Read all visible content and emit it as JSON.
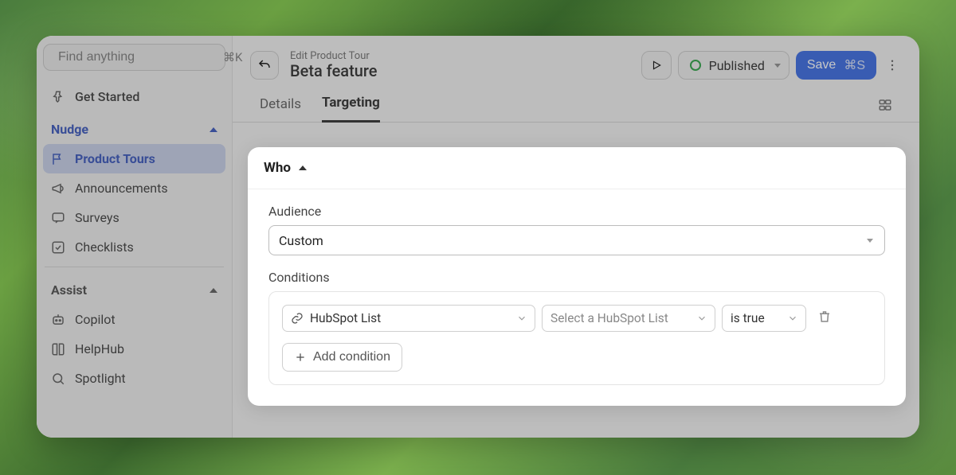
{
  "search": {
    "placeholder": "Find anything",
    "shortcut": "⌘K"
  },
  "sidebar": {
    "get_started": "Get Started",
    "nudge_label": "Nudge",
    "nudge_items": [
      {
        "label": "Product Tours"
      },
      {
        "label": "Announcements"
      },
      {
        "label": "Surveys"
      },
      {
        "label": "Checklists"
      }
    ],
    "assist_label": "Assist",
    "assist_items": [
      {
        "label": "Copilot"
      },
      {
        "label": "HelpHub"
      },
      {
        "label": "Spotlight"
      }
    ]
  },
  "header": {
    "crumb": "Edit Product Tour",
    "title": "Beta feature",
    "status": "Published",
    "save_label": "Save",
    "save_shortcut": "⌘S"
  },
  "tabs": {
    "details": "Details",
    "targeting": "Targeting"
  },
  "who": {
    "title": "Who",
    "audience_label": "Audience",
    "audience_value": "Custom",
    "conditions_label": "Conditions",
    "condition_attr": "HubSpot List",
    "condition_value_placeholder": "Select a HubSpot List",
    "condition_op": "is true",
    "add_condition": "Add condition"
  }
}
